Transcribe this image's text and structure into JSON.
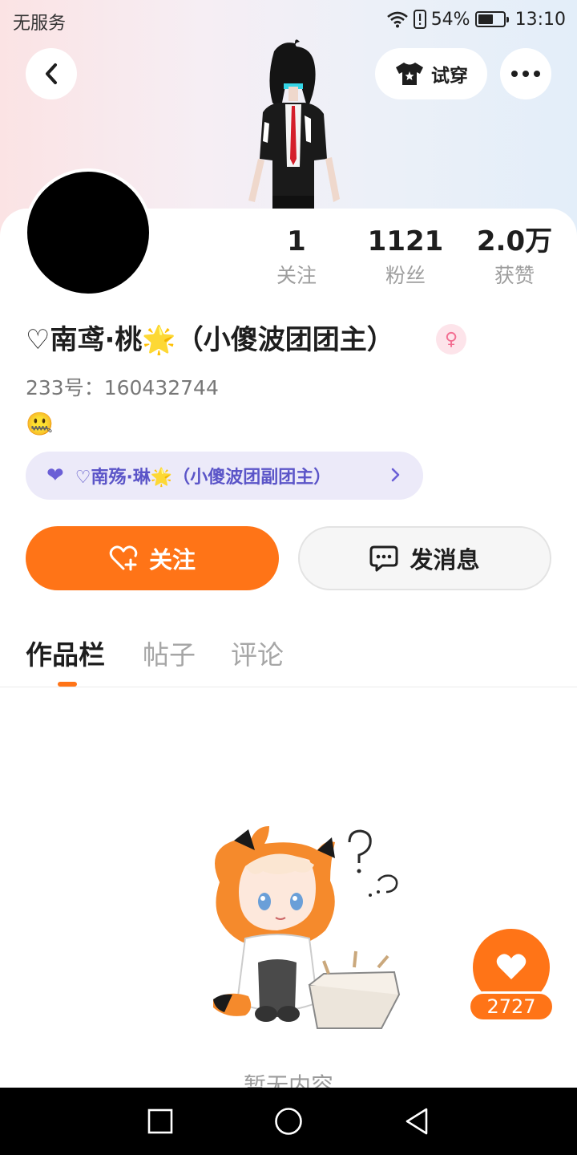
{
  "status_bar": {
    "carrier": "无服务",
    "battery": "54%",
    "time": "13:10",
    "icons": [
      "wifi-icon",
      "alert-icon",
      "battery-icon"
    ]
  },
  "header": {
    "back_icon": "chevron-left-icon",
    "try_on_label": "试穿",
    "try_on_icon": "tshirt-icon",
    "more_icon": "more-dots-icon"
  },
  "profile": {
    "stats": [
      {
        "value": "1",
        "label": "关注"
      },
      {
        "value": "1121",
        "label": "粉丝"
      },
      {
        "value": "2.0万",
        "label": "获赞"
      }
    ],
    "nickname": "♡南鸢·桃🌟（小傻波团团主）",
    "gender_icon": "female-icon",
    "uid": "233号：160432744",
    "signature": "🤐",
    "cp": {
      "name": "♡南殇·琳🌟（小傻波团副团主）",
      "icon": "heart-icon"
    }
  },
  "actions": {
    "follow_label": "关注",
    "message_label": "发消息"
  },
  "tabs": [
    {
      "label": "作品栏",
      "active": true
    },
    {
      "label": "帖子",
      "active": false
    },
    {
      "label": "评论",
      "active": false
    }
  ],
  "empty_state": {
    "text": "暂无内容"
  },
  "like_button": {
    "count": "2727"
  },
  "colors": {
    "accent": "#ff7417",
    "cp_text": "#5b55c8",
    "cp_bg": "#eceaf9"
  }
}
